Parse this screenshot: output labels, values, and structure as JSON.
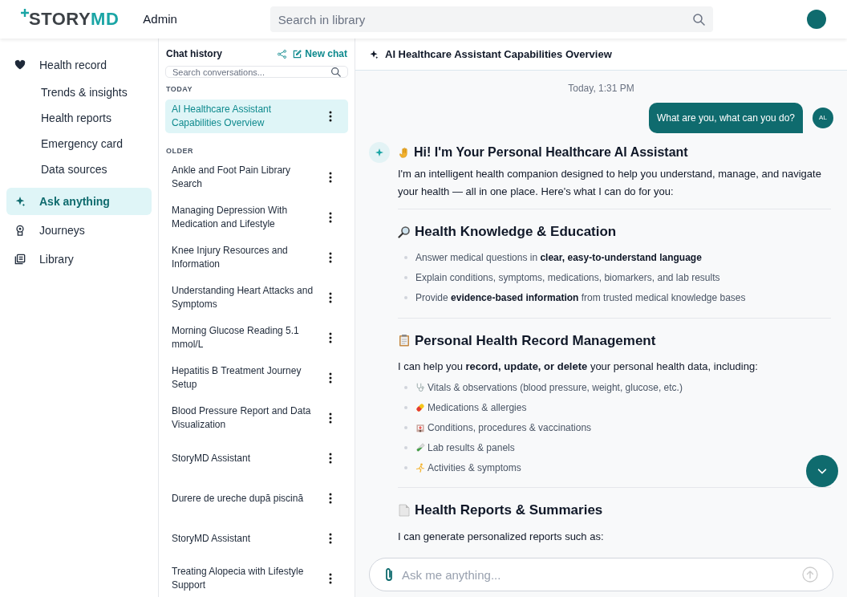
{
  "header": {
    "logo": [
      "STORY",
      "MD"
    ],
    "section": "Admin",
    "search": {
      "placeholder": "Search in library"
    }
  },
  "sidebar": {
    "items": [
      {
        "label": "Health record",
        "kind": "heart",
        "selected": false,
        "children": [
          {
            "label": "Trends & insights",
            "selected": false
          },
          {
            "label": "Health reports",
            "selected": false
          },
          {
            "label": "Emergency card",
            "selected": false
          },
          {
            "label": "Data sources",
            "selected": false
          }
        ]
      },
      {
        "label": "Ask anything",
        "kind": "sparkle",
        "selected": true
      },
      {
        "label": "Journeys",
        "kind": "award",
        "selected": false
      },
      {
        "label": "Library",
        "kind": "library",
        "selected": false
      }
    ]
  },
  "chat_history": {
    "title": "Chat history",
    "new_chat": "New chat",
    "search": {
      "placeholder": "Search conversations..."
    },
    "groups": [
      {
        "label": "TODAY",
        "chats": [
          {
            "title": "AI Healthcare Assistant Capabilities Overview",
            "selected": true
          }
        ]
      },
      {
        "label": "OLDER",
        "chats": [
          {
            "title": "Ankle and Foot Pain Library Search",
            "selected": false
          },
          {
            "title": "Managing Depression With Medication and Lifestyle",
            "selected": false
          },
          {
            "title": "Knee Injury Resources and Information",
            "selected": false
          },
          {
            "title": "Understanding Heart Attacks and Symptoms",
            "selected": false
          },
          {
            "title": "Morning Glucose Reading 5.1 mmol/L",
            "selected": false
          },
          {
            "title": "Hepatitis B Treatment Journey Setup",
            "selected": false
          },
          {
            "title": "Blood Pressure Report and Data Visualization",
            "selected": false
          },
          {
            "title": "StoryMD Assistant",
            "selected": false
          },
          {
            "title": "Durere de ureche după piscină",
            "selected": false
          },
          {
            "title": "StoryMD Assistant",
            "selected": false
          },
          {
            "title": "Treating Alopecia with Lifestyle Support",
            "selected": false
          }
        ]
      }
    ]
  },
  "conversation": {
    "title": "AI Healthcare Assistant Capabilities Overview",
    "timestamp": "Today, 1:31 PM",
    "user_message": {
      "text": "What are you, what can you do?",
      "avatar": "AL"
    },
    "reply": [
      {
        "kind": "title",
        "text": "Hi! I'm Your Personal Healthcare AI Assistant"
      },
      {
        "kind": "paragraph",
        "text": "I'm an intelligent health companion designed to help you understand, manage, and navigate your health — all in one place. Here's what I can do for you:"
      },
      {
        "kind": "divider"
      },
      {
        "kind": "heading",
        "text": "Health Knowledge & Education"
      },
      {
        "kind": "bullets",
        "items": [
          {
            "text": "Answer medical questions in **clear, easy-to-understand language**"
          },
          {
            "text": "Explain conditions, symptoms, medications, biomarkers, and lab results"
          },
          {
            "text": "Provide **evidence-based information** from trusted medical knowledge bases"
          }
        ]
      },
      {
        "kind": "divider"
      },
      {
        "kind": "heading",
        "text": "Personal Health Record Management"
      },
      {
        "kind": "paragraph",
        "text": "I can help you **record, update, or delete** your personal health data, including:"
      },
      {
        "kind": "bullets",
        "items": [
          {
            "text": "Vitals & observations (blood pressure, weight, glucose, etc.)"
          },
          {
            "text": "Medications & allergies"
          },
          {
            "text": "Conditions, procedures & vaccinations"
          },
          {
            "text": "Lab results & panels"
          },
          {
            "text": "Activities & symptoms"
          }
        ]
      },
      {
        "kind": "divider"
      },
      {
        "kind": "heading",
        "text": "Health Reports & Summaries"
      },
      {
        "kind": "paragraph",
        "text": "I can generate personalized reports such as:"
      }
    ],
    "input": {
      "placeholder": "Ask me anything..."
    }
  }
}
